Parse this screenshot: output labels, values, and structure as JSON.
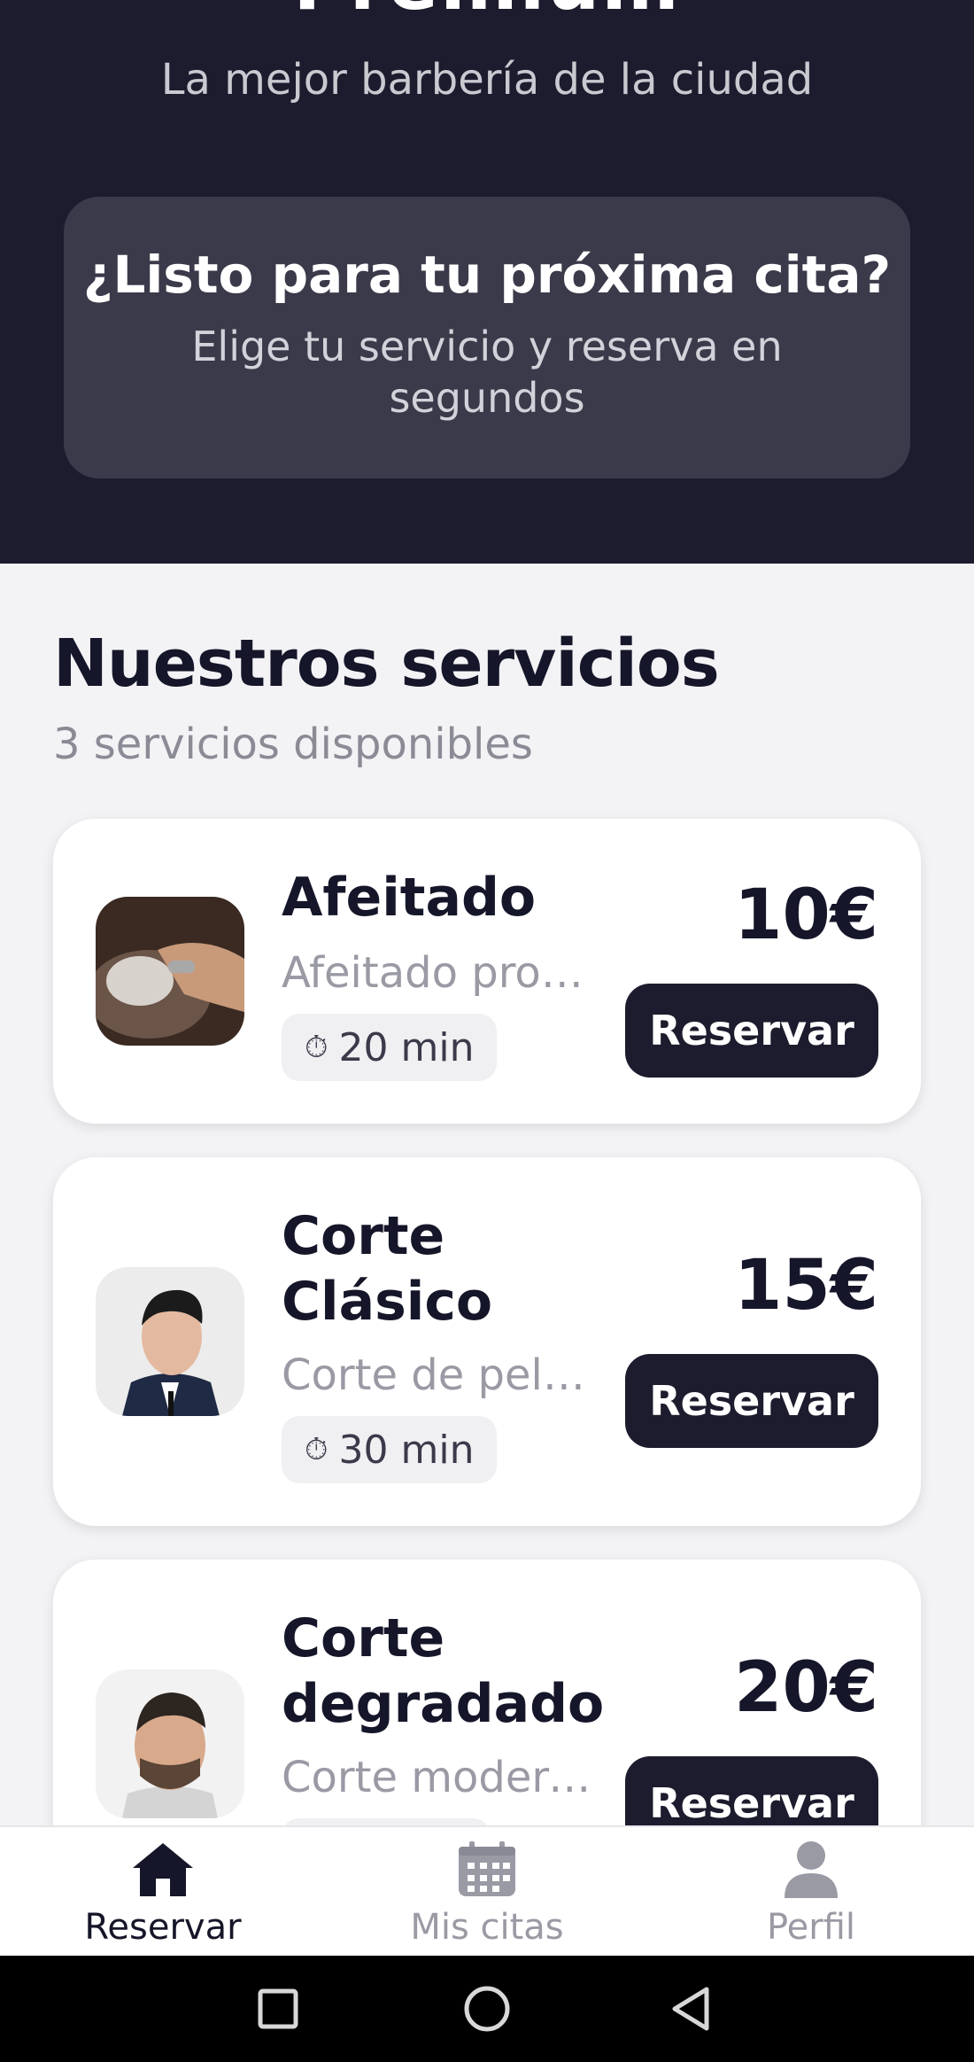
{
  "header": {
    "title": "Premium",
    "subtitle": "La mejor barbería de la ciudad"
  },
  "promo": {
    "title": "¿Listo para tu próxima cita?",
    "text": "Elige tu servicio y reserva en segundos"
  },
  "services": {
    "title": "Nuestros servicios",
    "count": "3 servicios disponibles",
    "items": [
      {
        "name": "Afeitado",
        "desc": "Afeitado profe...",
        "duration": "20 min",
        "price": "10€",
        "button": "Reservar",
        "image": "shaving-photo"
      },
      {
        "name": "Corte Clásico",
        "desc": "Corte de pelo ...",
        "duration": "30 min",
        "price": "15€",
        "button": "Reservar",
        "image": "classic-haircut-photo"
      },
      {
        "name": "Corte degradado",
        "desc": "Corte modern...",
        "duration": "",
        "price": "20€",
        "button": "Reservar",
        "image": "fade-haircut-photo"
      }
    ]
  },
  "tabbar": {
    "items": [
      {
        "label": "Reservar",
        "icon": "home-icon",
        "active": true
      },
      {
        "label": "Mis citas",
        "icon": "calendar-icon",
        "active": false
      },
      {
        "label": "Perfil",
        "icon": "user-icon",
        "active": false
      }
    ]
  },
  "colors": {
    "hero": "#1c1c2e",
    "promo": "#3a3a4a",
    "button": "#1c1c2e",
    "active_tab": "#16162a",
    "inactive_tab": "#9a9aa5"
  }
}
